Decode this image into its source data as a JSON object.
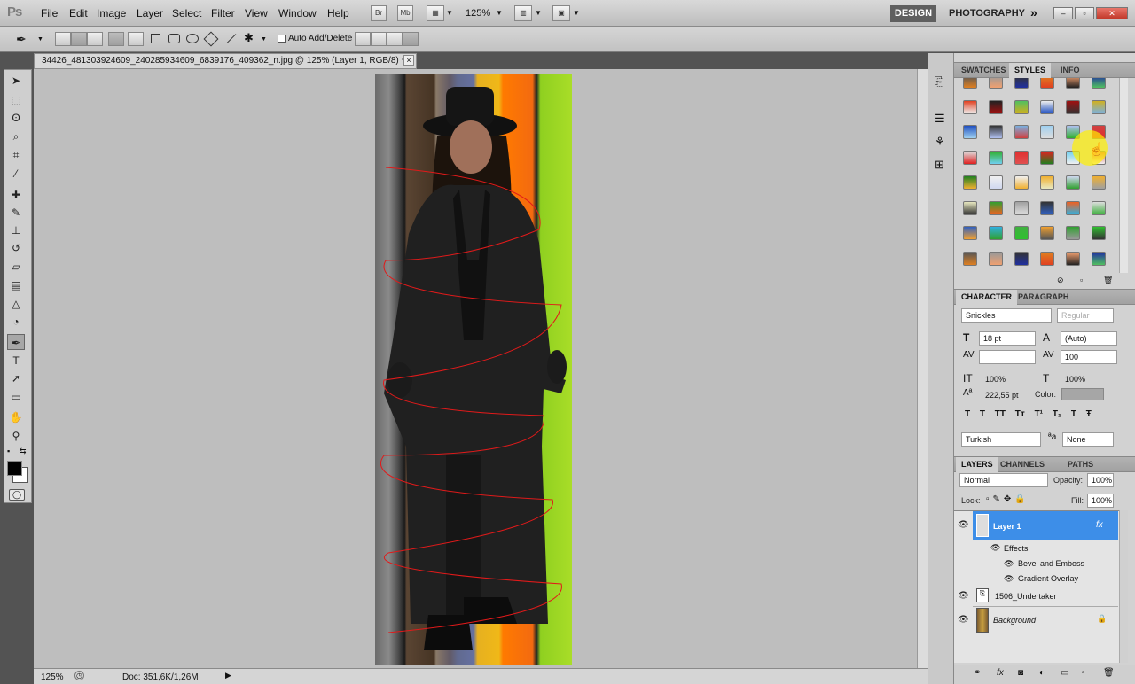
{
  "app": {
    "logo": "Ps"
  },
  "menu": {
    "items": [
      "File",
      "Edit",
      "Image",
      "Layer",
      "Select",
      "Filter",
      "View",
      "Window",
      "Help"
    ]
  },
  "appbar": {
    "br": "Br",
    "mb": "Mb",
    "zoom": "125%",
    "workspace_active": "DESIGN",
    "workspace_other": "PHOTOGRAPHY",
    "more": "»"
  },
  "options": {
    "auto_add_delete": "Auto Add/Delete"
  },
  "document": {
    "title": "34426_481303924609_240285934609_6839176_409362_n.jpg @ 125% (Layer 1, RGB/8) *",
    "close": "×"
  },
  "status": {
    "zoom": "125%",
    "doc": "Doc: 351,6K/1,26M"
  },
  "swatches_panel": {
    "tabs": [
      "SWATCHES",
      "STYLES",
      "INFO"
    ],
    "active_tab": "STYLES"
  },
  "character": {
    "tabs": [
      "CHARACTER",
      "PARAGRAPH"
    ],
    "font_family": "Snickles",
    "font_style": "Regular",
    "size": "18 pt",
    "leading": "(Auto)",
    "kerning": "",
    "tracking": "100",
    "vscale": "100%",
    "hscale": "100%",
    "baseline": "222,55 pt",
    "color_label": "Color:",
    "style_buttons": [
      "T",
      "T",
      "TT",
      "Tт",
      "T¹",
      "T₁",
      "T",
      "Ŧ"
    ],
    "language": "Turkish",
    "aa_label": "ªa",
    "antialias": "None"
  },
  "layers_panel": {
    "tabs": [
      "LAYERS",
      "CHANNELS",
      "PATHS"
    ],
    "blend_mode": "Normal",
    "opacity_label": "Opacity:",
    "opacity": "100%",
    "lock_label": "Lock:",
    "fill_label": "Fill:",
    "fill": "100%",
    "layers": [
      {
        "name": "Layer 1",
        "fx": "fx"
      },
      {
        "name": "Effects"
      },
      {
        "name": "Bevel and Emboss"
      },
      {
        "name": "Gradient Overlay"
      },
      {
        "name": "1506_Undertaker"
      },
      {
        "name": "Background"
      }
    ]
  },
  "colors": {
    "accent": "#3d8ee8",
    "canvas": "#bebebe",
    "panel": "#d2d2d2"
  }
}
